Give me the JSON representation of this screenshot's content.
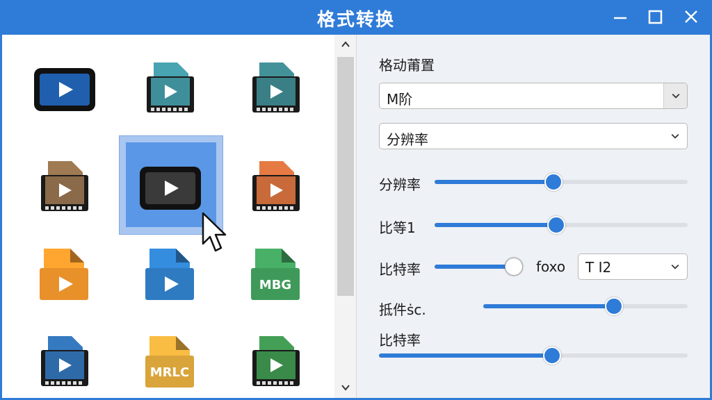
{
  "window": {
    "title": "格式转换"
  },
  "colors": {
    "accent": "#2f7bd8",
    "selection": "#5a97e6"
  },
  "files": [
    {
      "name": "video-file-1",
      "icon": "video-screen-icon",
      "color": "#1f5fae"
    },
    {
      "name": "video-file-2",
      "icon": "video-film-icon",
      "color": "#3f8f9a"
    },
    {
      "name": "video-file-3",
      "icon": "video-film-icon",
      "color": "#3a7f86"
    },
    {
      "name": "video-file-4",
      "icon": "video-film-icon",
      "color": "#8a6a48"
    },
    {
      "name": "video-file-5",
      "icon": "video-screen-icon",
      "color": "#3a3a3a"
    },
    {
      "name": "video-file-6",
      "icon": "video-film-icon",
      "color": "#c86a3a"
    },
    {
      "name": "video-file-7",
      "icon": "video-file-icon",
      "color": "#e8902a"
    },
    {
      "name": "video-file-8",
      "icon": "video-file-icon",
      "color": "#2e7bc2"
    },
    {
      "name": "video-file-9",
      "icon": "video-file-icon",
      "color": "#3f9a5a",
      "label": "MBG"
    },
    {
      "name": "video-file-10",
      "icon": "video-film-icon",
      "color": "#2e6aa8"
    },
    {
      "name": "video-file-11",
      "icon": "video-file-icon",
      "color": "#d9a43a",
      "label": "MRLC"
    },
    {
      "name": "video-file-12",
      "icon": "video-film-icon",
      "color": "#3a8a4a"
    }
  ],
  "settings": {
    "heading": "格动莆置",
    "format_select": "M阶",
    "resolution_select": "分辨率",
    "sliders": [
      {
        "label": "分辨率",
        "value": 0.47
      },
      {
        "label": "比等1",
        "value": 0.48
      },
      {
        "label": "比特率",
        "value": 0.92
      },
      {
        "label": "抵件ṡc.",
        "value": 0.64
      },
      {
        "label": "比特率",
        "value": 0.56
      }
    ],
    "codec_label": "foxo",
    "codec_select": "T I2"
  }
}
